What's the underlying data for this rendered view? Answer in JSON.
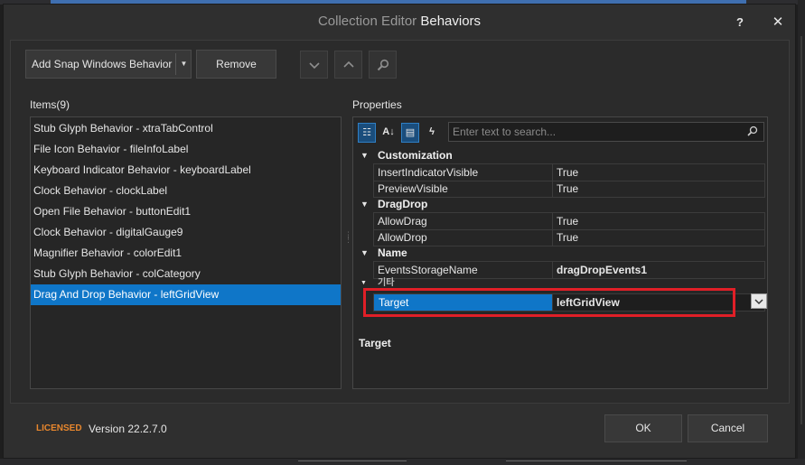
{
  "dialog": {
    "title_prefix": "Collection Editor",
    "title_main": "Behaviors",
    "help_label": "?",
    "close_label": "✕"
  },
  "toolbar": {
    "add_label": "Add Snap Windows Behavior",
    "remove_label": "Remove",
    "icons": [
      "chevron-down-icon",
      "chevron-up-icon",
      "search-icon"
    ]
  },
  "items": {
    "header": "Items(9)",
    "list": [
      "Stub Glyph Behavior - xtraTabControl",
      "File Icon Behavior - fileInfoLabel",
      "Keyboard Indicator Behavior - keyboardLabel",
      "Clock Behavior - clockLabel",
      "Open File Behavior - buttonEdit1",
      "Clock Behavior - digitalGauge9",
      "Magnifier Behavior - colorEdit1",
      "Stub Glyph Behavior - colCategory",
      "Drag And Drop Behavior - leftGridView"
    ],
    "selected_index": 8
  },
  "properties": {
    "header": "Properties",
    "search_placeholder": "Enter text to search...",
    "categories": [
      {
        "name": "Customization",
        "props": [
          {
            "name": "InsertIndicatorVisible",
            "value": "True"
          },
          {
            "name": "PreviewVisible",
            "value": "True"
          }
        ]
      },
      {
        "name": "DragDrop",
        "props": [
          {
            "name": "AllowDrag",
            "value": "True"
          },
          {
            "name": "AllowDrop",
            "value": "True"
          }
        ]
      },
      {
        "name": "Name",
        "props": [
          {
            "name": "EventsStorageName",
            "value": "dragDropEvents1"
          }
        ]
      },
      {
        "name": "기타",
        "props": [
          {
            "name": "Target",
            "value": "leftGridView"
          }
        ]
      }
    ],
    "description_title": "Target"
  },
  "footer": {
    "licensed": "LICENSED",
    "version": "Version 22.2.7.0",
    "ok_label": "OK",
    "cancel_label": "Cancel"
  },
  "colors": {
    "selection": "#0f76c8",
    "highlight": "#e01f27",
    "licensed": "#e8872d",
    "background": "#2b2b2b"
  }
}
